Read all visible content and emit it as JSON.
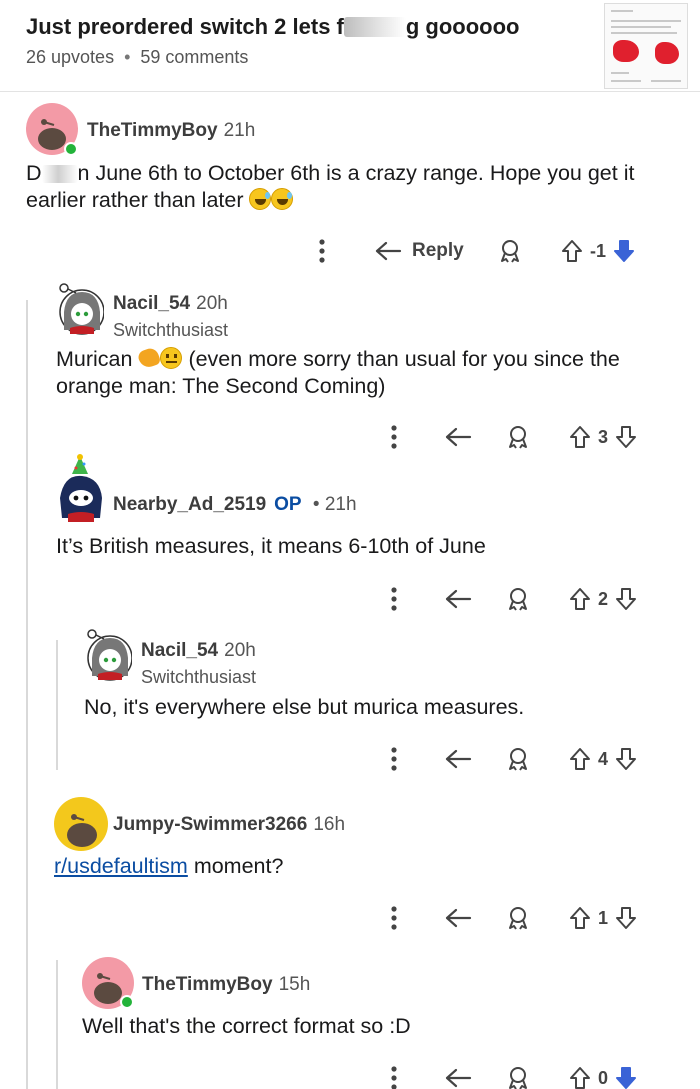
{
  "post": {
    "title_start": "Just preordered switch 2 lets f",
    "title_end": "g goooooo",
    "upvotes": "26 upvotes",
    "comments": "59 comments"
  },
  "comments": [
    {
      "username": "TheTimmyBoy",
      "time": "21h",
      "body_prefix": "D",
      "body_line1": "n June 6th to October 6th is a crazy range. Hope you get it",
      "body_line2": "earlier rather than later",
      "reply_label": "Reply",
      "votes": "-1"
    },
    {
      "username": "Nacil_54",
      "time": "20h",
      "flair": "Switchthusiast",
      "body_line1_a": "Murican",
      "body_line1_b": "(even more sorry than usual for you since the",
      "body_line2": "orange man: The Second Coming)",
      "votes": "3"
    },
    {
      "username": "Nearby_Ad_2519",
      "op_badge": "OP",
      "time": "21h",
      "body": "It’s British measures, it means 6-10th of June",
      "votes": "2"
    },
    {
      "username": "Nacil_54",
      "time": "20h",
      "flair": "Switchthusiast",
      "body": "No, it's everywhere else but murica measures.",
      "votes": "4"
    },
    {
      "username": "JumpySwimmer3266_display",
      "display_name": "Jumpy-Swimmer3266",
      "time": "16h",
      "link": "r/usdefaultism",
      "body_rest": " moment?",
      "votes": "1"
    },
    {
      "username": "TheTimmyBoy",
      "time": "15h",
      "body": "Well that's the correct format so :D",
      "votes": "0"
    }
  ],
  "colors": {
    "accent_link": "#0b4da2",
    "online": "#23b33a",
    "downvote_active": "#3a63d6",
    "avatar_pink": "#f39aa6",
    "avatar_yellow": "#f3c81c"
  }
}
